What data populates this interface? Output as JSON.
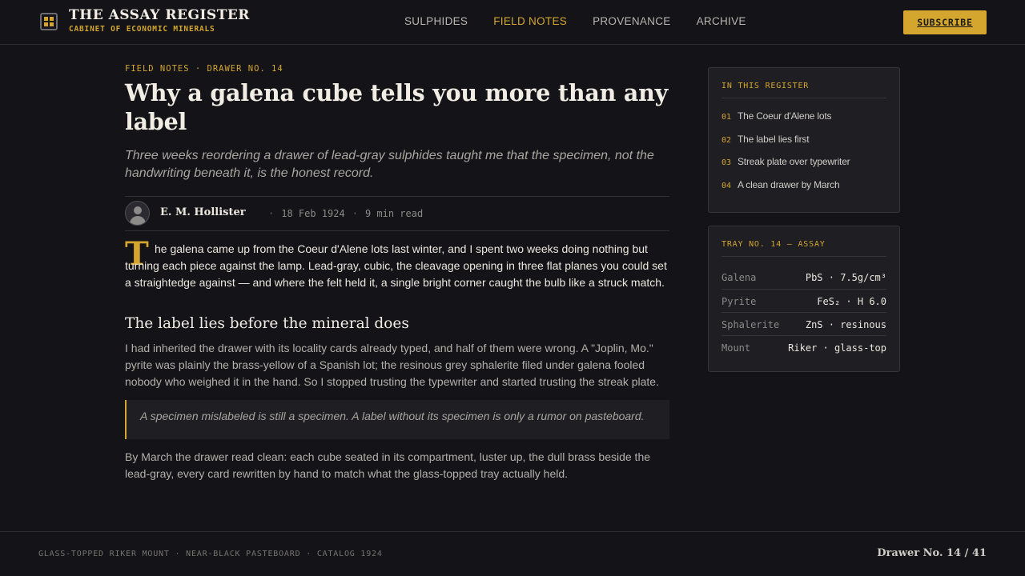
{
  "header": {
    "brand_title": "THE ASSAY REGISTER",
    "brand_subtitle": "CABINET OF ECONOMIC MINERALS",
    "logo_icon": "drawer-grid-icon",
    "nav": [
      {
        "label": "SULPHIDES",
        "active": false
      },
      {
        "label": "FIELD NOTES",
        "active": true
      },
      {
        "label": "PROVENANCE",
        "active": false
      },
      {
        "label": "ARCHIVE",
        "active": false
      }
    ],
    "subscribe_label": "SUBSCRIBE"
  },
  "article": {
    "kicker": "FIELD NOTES · DRAWER NO. 14",
    "title": "Why a galena cube tells you more than any label",
    "dek": "Three weeks reordering a drawer of lead-gray sulphides taught me that the specimen, not the handwriting beneath it, is the honest record.",
    "author": "E. M. Hollister",
    "date": "18 Feb 1924",
    "read_time": "9 min read",
    "dropcap": "T",
    "lead": "he galena came up from the Coeur d'Alene lots last winter, and I spent two weeks doing nothing but turning each piece against the lamp. Lead-gray, cubic, the cleavage opening in three flat planes you could set a straightedge against — and where the felt held it, a single bright corner caught the bulb like a struck match.",
    "section_heading": "The label lies before the mineral does",
    "paragraph_2": "I had inherited the drawer with its locality cards already typed, and half of them were wrong. A \"Joplin, Mo.\" pyrite was plainly the brass-yellow of a Spanish lot; the resinous grey sphalerite filed under galena fooled nobody who weighed it in the hand. So I stopped trusting the typewriter and started trusting the streak plate.",
    "quote": "A specimen mislabeled is still a specimen. A label without its specimen is only a rumor on pasteboard.",
    "paragraph_3": "By March the drawer read clean: each cube seated in its compartment, luster up, the dull brass beside the lead-gray, every card rewritten by hand to match what the glass-topped tray actually held."
  },
  "toc": {
    "title": "IN THIS REGISTER",
    "items": [
      {
        "num": "01",
        "label": "The Coeur d'Alene lots"
      },
      {
        "num": "02",
        "label": "The label lies first"
      },
      {
        "num": "03",
        "label": "Streak plate over typewriter"
      },
      {
        "num": "04",
        "label": "A clean drawer by March"
      }
    ]
  },
  "tray": {
    "title": "TRAY NO. 14 — ASSAY",
    "rows": [
      {
        "key": "Galena",
        "value": "PbS · 7.5g/cm³"
      },
      {
        "key": "Pyrite",
        "value": "FeS₂ · H 6.0"
      },
      {
        "key": "Sphalerite",
        "value": "ZnS · resinous"
      },
      {
        "key": "Mount",
        "value": "Riker · glass-top"
      }
    ]
  },
  "footer": {
    "left": "GLASS-TOPPED RIKER MOUNT · NEAR-BLACK PASTEBOARD · CATALOG 1924",
    "right": "Drawer No. 14 / 41"
  },
  "colors": {
    "accent": "#d4a62e",
    "background": "#141418",
    "card": "#1e1e23"
  }
}
